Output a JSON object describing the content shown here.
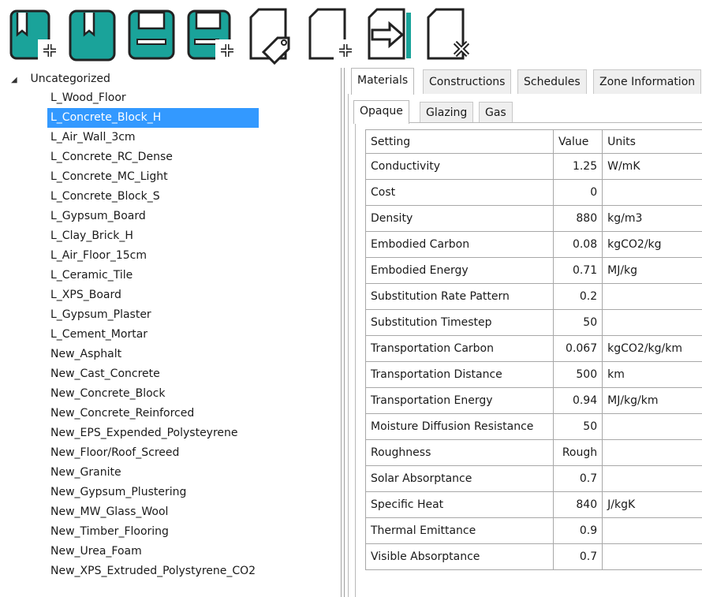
{
  "toolbar": {
    "buttons": [
      {
        "name": "new-library-button",
        "icon": "book-plus-icon"
      },
      {
        "name": "open-library-button",
        "icon": "book-icon"
      },
      {
        "name": "save-button",
        "icon": "floppy-icon"
      },
      {
        "name": "save-as-button",
        "icon": "floppy-plus-icon"
      },
      {
        "name": "tag-button",
        "icon": "page-tag-icon"
      },
      {
        "name": "add-item-button",
        "icon": "page-plus-icon"
      },
      {
        "name": "import-button",
        "icon": "page-arrow-icon"
      },
      {
        "name": "delete-item-button",
        "icon": "page-x-icon"
      }
    ],
    "accent": "#1aa39a"
  },
  "tree": {
    "root_label": "Uncategorized",
    "selected_index": 1,
    "items": [
      "L_Wood_Floor",
      "L_Concrete_Block_H",
      "L_Air_Wall_3cm",
      "L_Concrete_RC_Dense",
      "L_Concrete_MC_Light",
      "L_Concrete_Block_S",
      "L_Gypsum_Board",
      "L_Clay_Brick_H",
      "L_Air_Floor_15cm",
      "L_Ceramic_Tile",
      "L_XPS_Board",
      "L_Gypsum_Plaster",
      "L_Cement_Mortar",
      "New_Asphalt",
      "New_Cast_Concrete",
      "New_Concrete_Block",
      "New_Concrete_Reinforced",
      "New_EPS_Expended_Polysteyrene",
      "New_Floor/Roof_Screed",
      "New_Granite",
      "New_Gypsum_Plustering",
      "New_MW_Glass_Wool",
      "New_Timber_Flooring",
      "New_Urea_Foam",
      "New_XPS_Extruded_Polystyrene_CO2"
    ]
  },
  "tabs": {
    "main": [
      "Materials",
      "Constructions",
      "Schedules",
      "Zone Information"
    ],
    "active_main": 0,
    "sub": [
      "Opaque",
      "Glazing",
      "Gas"
    ],
    "active_sub": 0
  },
  "grid": {
    "headers": {
      "setting": "Setting",
      "value": "Value",
      "units": "Units"
    },
    "rows": [
      {
        "setting": "Conductivity",
        "value": "1.25",
        "units": "W/mK"
      },
      {
        "setting": "Cost",
        "value": "0",
        "units": ""
      },
      {
        "setting": "Density",
        "value": "880",
        "units": "kg/m3"
      },
      {
        "setting": "Embodied Carbon",
        "value": "0.08",
        "units": "kgCO2/kg"
      },
      {
        "setting": "Embodied Energy",
        "value": "0.71",
        "units": "MJ/kg"
      },
      {
        "setting": "Substitution Rate Pattern",
        "value": "0.2",
        "units": ""
      },
      {
        "setting": "Substitution Timestep",
        "value": "50",
        "units": ""
      },
      {
        "setting": "Transportation Carbon",
        "value": "0.067",
        "units": "kgCO2/kg/km"
      },
      {
        "setting": "Transportation Distance",
        "value": "500",
        "units": "km"
      },
      {
        "setting": "Transportation Energy",
        "value": "0.94",
        "units": "MJ/kg/km"
      },
      {
        "setting": "Moisture Diffusion Resistance",
        "value": "50",
        "units": ""
      },
      {
        "setting": "Roughness",
        "value": "Rough",
        "units": ""
      },
      {
        "setting": "Solar Absorptance",
        "value": "0.7",
        "units": ""
      },
      {
        "setting": "Specific Heat",
        "value": "840",
        "units": "J/kgK"
      },
      {
        "setting": "Thermal Emittance",
        "value": "0.9",
        "units": ""
      },
      {
        "setting": "Visible Absorptance",
        "value": "0.7",
        "units": ""
      }
    ]
  }
}
